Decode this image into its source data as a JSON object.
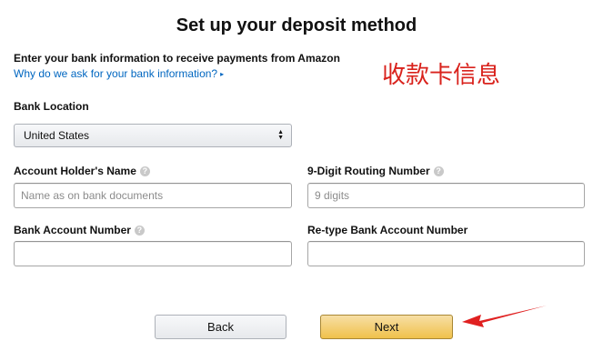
{
  "header": {
    "title": "Set up your deposit method",
    "intro": "Enter your bank information to receive payments from Amazon",
    "help_link": "Why do we ask for your bank information?"
  },
  "annotation": "收款卡信息",
  "form": {
    "bank_location_label": "Bank Location",
    "bank_location_value": "United States",
    "account_holder_label": "Account Holder's Name",
    "account_holder_placeholder": "Name as on bank documents",
    "routing_label": "9-Digit Routing Number",
    "routing_placeholder": "9 digits",
    "account_number_label": "Bank Account Number",
    "retype_account_label": "Re-type Bank Account Number",
    "help_icon_glyph": "?"
  },
  "buttons": {
    "back": "Back",
    "next": "Next"
  },
  "colors": {
    "annotation": "#d9221c",
    "link": "#0066c0",
    "next_button": "#f0c14b"
  }
}
